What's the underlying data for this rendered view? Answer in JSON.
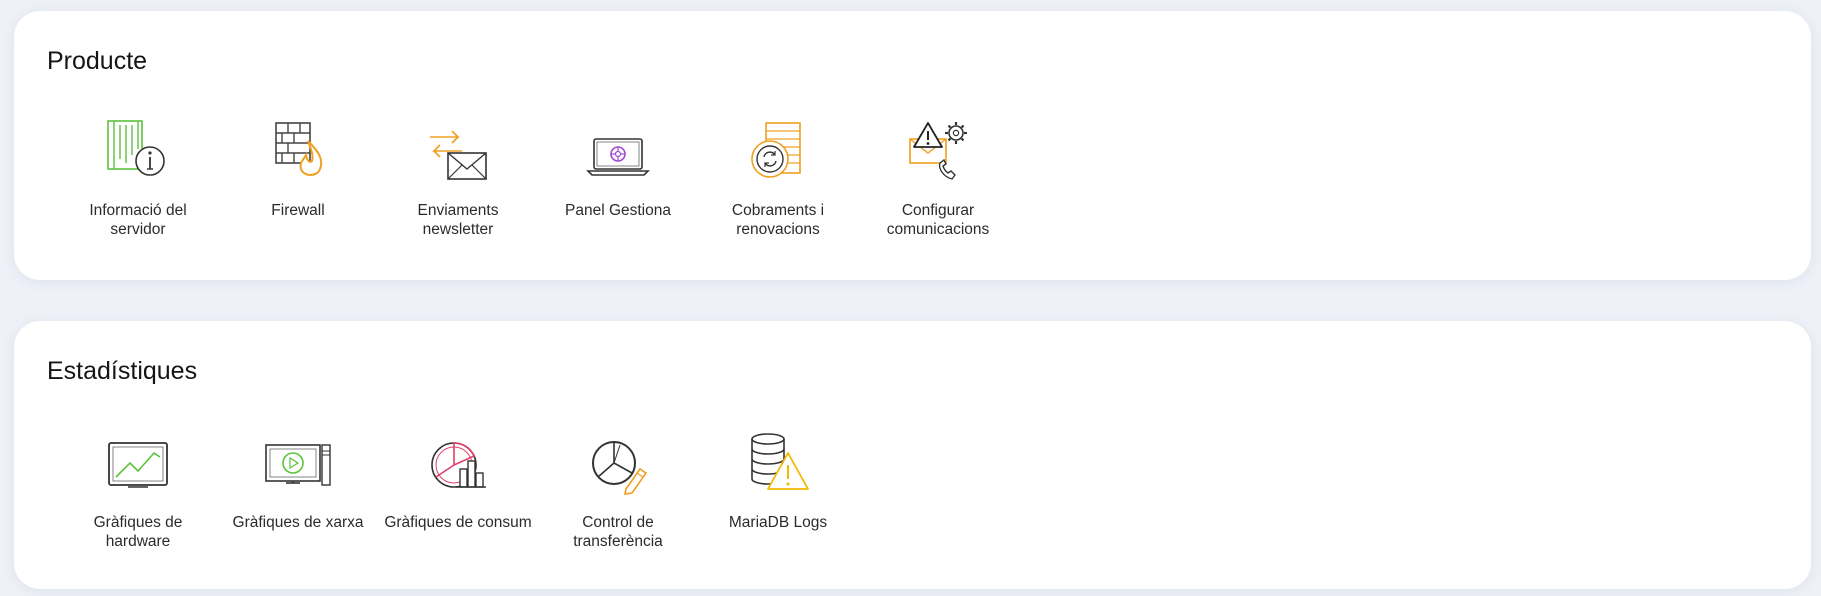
{
  "sections": [
    {
      "title": "Producte",
      "items": [
        {
          "label": "Informació del servidor",
          "icon": "server-info-icon"
        },
        {
          "label": "Firewall",
          "icon": "firewall-icon"
        },
        {
          "label": "Enviaments newsletter",
          "icon": "newsletter-icon"
        },
        {
          "label": "Panel Gestiona",
          "icon": "panel-laptop-icon"
        },
        {
          "label": "Cobraments i renovacions",
          "icon": "billing-renewals-icon"
        },
        {
          "label": "Configurar comunicacions",
          "icon": "communications-settings-icon"
        }
      ]
    },
    {
      "title": "Estadístiques",
      "items": [
        {
          "label": "Gràfiques de hardware",
          "icon": "hardware-chart-icon"
        },
        {
          "label": "Gràfiques de xarxa",
          "icon": "network-chart-icon"
        },
        {
          "label": "Gràfiques de consum",
          "icon": "consumption-chart-icon"
        },
        {
          "label": "Control de transferència",
          "icon": "transfer-control-icon"
        },
        {
          "label": "MariaDB Logs",
          "icon": "database-logs-icon"
        }
      ]
    }
  ],
  "colors": {
    "background": "#eef1f7",
    "card": "#ffffff",
    "green": "#5cc23c",
    "orange": "#f0a020",
    "purple": "#a04bd0",
    "pink": "#e0406a",
    "yellow": "#f5b800",
    "outline": "#333333"
  }
}
